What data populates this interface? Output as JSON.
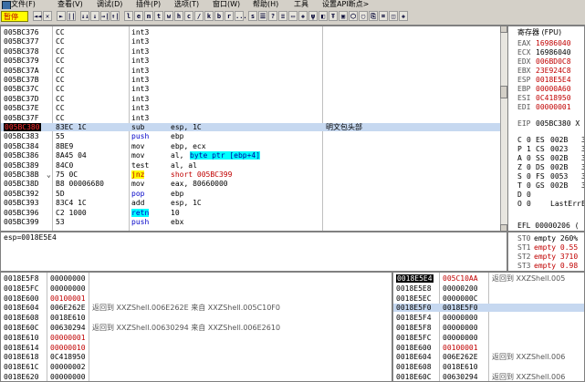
{
  "menu": {
    "icon": "app-icon",
    "items": [
      "文件(F)",
      "查看(V)",
      "调试(D)",
      "插件(P)",
      "选项(T)",
      "窗口(W)",
      "帮助(H)",
      "工具",
      "设置API断点>"
    ]
  },
  "toolbar": {
    "status": "暂停",
    "buttons": [
      "◄◄",
      "✕",
      "►",
      "||",
      "↓↓",
      "↓",
      "→|",
      "↑|",
      "l",
      "e",
      "m",
      "t",
      "w",
      "h",
      "c",
      "/",
      "k",
      "b",
      "r",
      "...",
      "s",
      "☰",
      "?",
      "≡",
      "▭",
      "◈",
      "ψ",
      "◧",
      "Ŧ",
      "▣",
      "⬡",
      "▢",
      "⎘",
      "⌗",
      "◫",
      "◈"
    ]
  },
  "disasm": {
    "rows": [
      {
        "addr": "005BC376",
        "hex": "CC",
        "mn": "int3",
        "op": "",
        "cm": ""
      },
      {
        "addr": "005BC377",
        "hex": "CC",
        "mn": "int3",
        "op": "",
        "cm": ""
      },
      {
        "addr": "005BC378",
        "hex": "CC",
        "mn": "int3",
        "op": "",
        "cm": ""
      },
      {
        "addr": "005BC379",
        "hex": "CC",
        "mn": "int3",
        "op": "",
        "cm": ""
      },
      {
        "addr": "005BC37A",
        "hex": "CC",
        "mn": "int3",
        "op": "",
        "cm": ""
      },
      {
        "addr": "005BC37B",
        "hex": "CC",
        "mn": "int3",
        "op": "",
        "cm": ""
      },
      {
        "addr": "005BC37C",
        "hex": "CC",
        "mn": "int3",
        "op": "",
        "cm": ""
      },
      {
        "addr": "005BC37D",
        "hex": "CC",
        "mn": "int3",
        "op": "",
        "cm": ""
      },
      {
        "addr": "005BC37E",
        "hex": "CC",
        "mn": "int3",
        "op": "",
        "cm": ""
      },
      {
        "addr": "005BC37F",
        "hex": "CC",
        "mn": "int3",
        "op": "",
        "cm": ""
      },
      {
        "addr": "005BC380",
        "hex": "83EC 1C",
        "mn": "sub",
        "op": "esp, 1C",
        "cm": "明文包头部"
      },
      {
        "addr": "005BC383",
        "hex": "55",
        "mn": "push",
        "op": "ebp",
        "cm": ""
      },
      {
        "addr": "005BC384",
        "hex": "8BE9",
        "mn": "mov",
        "op": "ebp, ecx",
        "cm": ""
      },
      {
        "addr": "005BC386",
        "hex": "8A45 04",
        "mn": "mov",
        "op": "al, ",
        "op2": "byte ptr [ebp+4]",
        "cm": ""
      },
      {
        "addr": "005BC389",
        "hex": "84C0",
        "mn": "test",
        "op": "al, al",
        "cm": ""
      },
      {
        "addr": "005BC38B",
        "hex": "75 0C",
        "mn": "jnz",
        "op": "short 005BC399",
        "cm": ""
      },
      {
        "addr": "005BC38D",
        "hex": "B8 00006680",
        "mn": "mov",
        "op": "eax, 80660000",
        "cm": ""
      },
      {
        "addr": "005BC392",
        "hex": "5D",
        "mn": "pop",
        "op": "ebp",
        "cm": ""
      },
      {
        "addr": "005BC393",
        "hex": "83C4 1C",
        "mn": "add",
        "op": "esp, 1C",
        "cm": ""
      },
      {
        "addr": "005BC396",
        "hex": "C2 1000",
        "mn": "retn",
        "op": "10",
        "cm": ""
      },
      {
        "addr": "005BC399",
        "hex": "53",
        "mn": "push",
        "op": "ebx",
        "cm": ""
      }
    ]
  },
  "info": {
    "line": "esp=0018E5E4"
  },
  "registers": {
    "title": "寄存器 (FPU)",
    "rows": [
      {
        "name": "EAX",
        "val": "16986040",
        "red": true
      },
      {
        "name": "ECX",
        "val": "16986040",
        "red": false
      },
      {
        "name": "EDX",
        "val": "006BD0C8",
        "red": true
      },
      {
        "name": "EBX",
        "val": "23E924C8",
        "red": true
      },
      {
        "name": "ESP",
        "val": "0018E5E4",
        "red": true
      },
      {
        "name": "EBP",
        "val": "00000A60",
        "red": true
      },
      {
        "name": "ESI",
        "val": "0C418950",
        "red": true
      },
      {
        "name": "EDI",
        "val": "00000001",
        "red": true
      }
    ],
    "eip": {
      "name": "EIP",
      "val": "005BC380 X"
    },
    "flags": [
      {
        "f": "C",
        "v": "0",
        "seg": "ES",
        "sv": "002B",
        "extra": "3"
      },
      {
        "f": "P",
        "v": "1",
        "seg": "CS",
        "sv": "0023",
        "extra": "3"
      },
      {
        "f": "A",
        "v": "0",
        "seg": "SS",
        "sv": "002B",
        "extra": "3"
      },
      {
        "f": "Z",
        "v": "0",
        "seg": "DS",
        "sv": "002B",
        "extra": "3"
      },
      {
        "f": "S",
        "v": "0",
        "seg": "FS",
        "sv": "0053",
        "extra": "3"
      },
      {
        "f": "T",
        "v": "0",
        "seg": "GS",
        "sv": "002B",
        "extra": "3"
      },
      {
        "f": "D",
        "v": "0",
        "seg": "",
        "sv": "",
        "extra": ""
      },
      {
        "f": "O",
        "v": "0",
        "seg": "",
        "sv": "LastErr",
        "extra": "E"
      }
    ],
    "efl": "EFL 00000206 (",
    "st": [
      {
        "n": "ST0",
        "v": "empty 260%",
        "red": false
      },
      {
        "n": "ST1",
        "v": "empty 0.55",
        "red": true
      },
      {
        "n": "ST2",
        "v": "empty 3710",
        "red": true
      },
      {
        "n": "ST3",
        "v": "empty 0.98",
        "red": true
      }
    ]
  },
  "dump": {
    "rows": [
      {
        "a": "0018E5F8",
        "v": "00000000",
        "red": false,
        "c": ""
      },
      {
        "a": "0018E5FC",
        "v": "00000000",
        "red": false,
        "c": ""
      },
      {
        "a": "0018E600",
        "v": "00100001",
        "red": true,
        "c": ""
      },
      {
        "a": "0018E604",
        "v": "006E262E",
        "red": false,
        "c": "返回到 XXZShell.006E262E 来自 XXZShell.005C10F0"
      },
      {
        "a": "0018E608",
        "v": "0018E610",
        "red": false,
        "c": ""
      },
      {
        "a": "0018E60C",
        "v": "00630294",
        "red": false,
        "c": "返回到 XXZShell.00630294 来自 XXZShell.006E2610"
      },
      {
        "a": "0018E610",
        "v": "00000001",
        "red": true,
        "c": ""
      },
      {
        "a": "0018E614",
        "v": "00000010",
        "red": true,
        "c": ""
      },
      {
        "a": "0018E618",
        "v": "0C418950",
        "red": false,
        "c": ""
      },
      {
        "a": "0018E61C",
        "v": "00000002",
        "red": false,
        "c": ""
      },
      {
        "a": "0018E620",
        "v": "00000000",
        "red": false,
        "c": ""
      }
    ]
  },
  "stack": {
    "rows": [
      {
        "a": "0018E5E4",
        "v": "005C10AA",
        "c": "返回到 XXZShell.005",
        "cur": true
      },
      {
        "a": "0018E5E8",
        "v": "00000200",
        "c": "",
        "cur": false
      },
      {
        "a": "0018E5EC",
        "v": "0000000C",
        "c": "",
        "cur": false
      },
      {
        "a": "0018E5F0",
        "v": "0018E5F0",
        "c": "",
        "cur": false,
        "sel": true
      },
      {
        "a": "0018E5F4",
        "v": "00000000",
        "c": "",
        "cur": false
      },
      {
        "a": "0018E5F8",
        "v": "00000000",
        "c": "",
        "cur": false
      },
      {
        "a": "0018E5FC",
        "v": "00000000",
        "c": "",
        "cur": false
      },
      {
        "a": "0018E600",
        "v": "00100001",
        "c": "",
        "cur": false,
        "red": true
      },
      {
        "a": "0018E604",
        "v": "006E262E",
        "c": "返回到 XXZShell.006",
        "cur": false
      },
      {
        "a": "0018E608",
        "v": "0018E610",
        "c": "",
        "cur": false
      },
      {
        "a": "0018E60C",
        "v": "00630294",
        "c": "返回到 XXZShell.006",
        "cur": false
      }
    ]
  }
}
